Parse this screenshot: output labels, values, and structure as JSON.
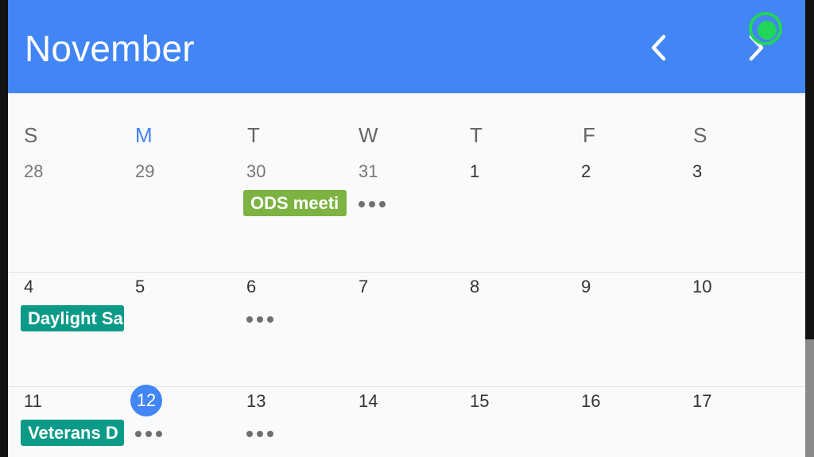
{
  "header": {
    "month": "November",
    "prev_icon": "chevron-left-icon",
    "next_icon": "chevron-right-icon",
    "background": "#4285f4"
  },
  "weekdays": [
    {
      "label": "S",
      "today": false
    },
    {
      "label": "M",
      "today": true
    },
    {
      "label": "T",
      "today": false
    },
    {
      "label": "W",
      "today": false
    },
    {
      "label": "T",
      "today": false
    },
    {
      "label": "F",
      "today": false
    },
    {
      "label": "S",
      "today": false
    }
  ],
  "weeks": [
    {
      "days": [
        {
          "num": "28",
          "other_month": true
        },
        {
          "num": "29",
          "other_month": true
        },
        {
          "num": "30",
          "other_month": true,
          "event": {
            "title": "ODS meeti",
            "color": "#7cb342"
          }
        },
        {
          "num": "31",
          "other_month": true,
          "more": true
        },
        {
          "num": "1"
        },
        {
          "num": "2"
        },
        {
          "num": "3"
        }
      ]
    },
    {
      "days": [
        {
          "num": "4",
          "event": {
            "title": "Daylight Sa",
            "color": "#0b9a87"
          }
        },
        {
          "num": "5"
        },
        {
          "num": "6",
          "more": true
        },
        {
          "num": "7"
        },
        {
          "num": "8"
        },
        {
          "num": "9"
        },
        {
          "num": "10"
        }
      ]
    },
    {
      "days": [
        {
          "num": "11",
          "event": {
            "title": "Veterans D",
            "color": "#0b9a87"
          }
        },
        {
          "num": "12",
          "today": true,
          "more": true
        },
        {
          "num": "13",
          "more": true
        },
        {
          "num": "14"
        },
        {
          "num": "15"
        },
        {
          "num": "16"
        },
        {
          "num": "17"
        }
      ]
    }
  ],
  "colors": {
    "accent": "#4285f4",
    "touch_indicator": "#22d55a"
  }
}
